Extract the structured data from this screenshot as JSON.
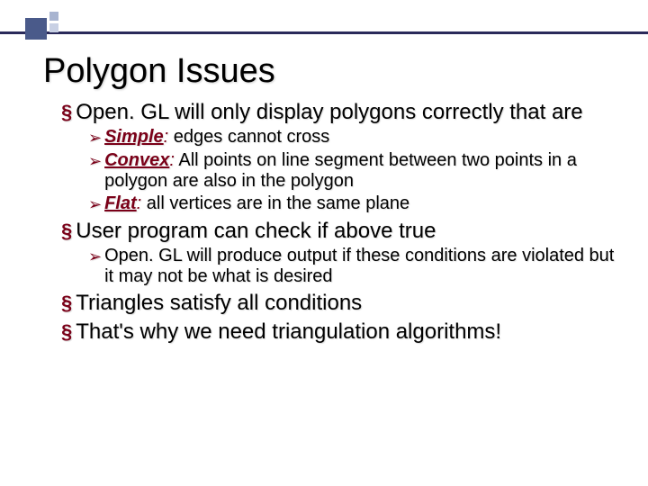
{
  "title": "Polygon Issues",
  "bullets": {
    "b1": "Open. GL will only display polygons correctly that are",
    "b1a_term": "Simple",
    "b1a_rest": " edges cannot cross",
    "b1b_term": "Convex",
    "b1b_rest": " All points on line segment between two points in a polygon are also in the polygon",
    "b1c_term": "Flat",
    "b1c_rest": " all vertices are in the same plane",
    "b2": "User program can check if above true",
    "b2a": "Open. GL will produce output if these conditions are violated but it may not be what is desired",
    "b3": "Triangles satisfy all conditions",
    "b4": "That's why we need triangulation algorithms!"
  }
}
